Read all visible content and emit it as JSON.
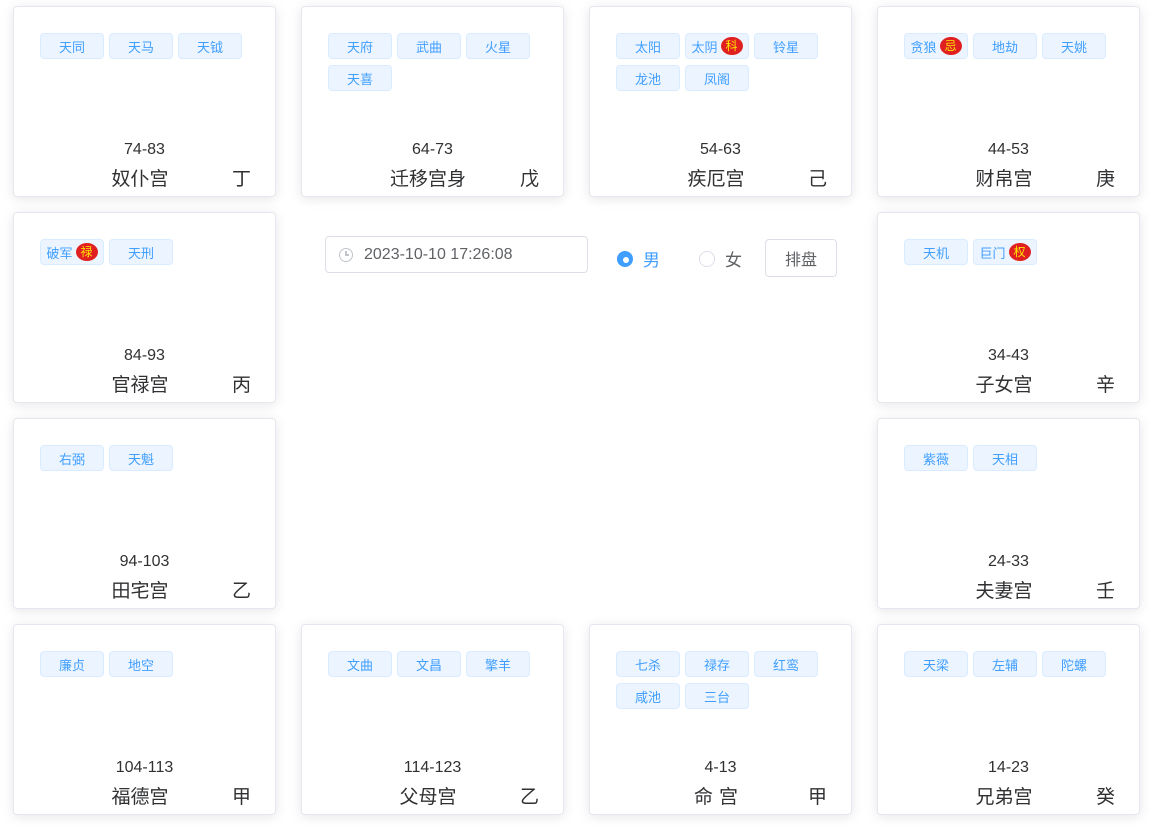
{
  "palaces": [
    {
      "id": "p0",
      "stars": [
        {
          "name": "天同"
        },
        {
          "name": "天马"
        },
        {
          "name": "天钺"
        }
      ],
      "range": "74-83",
      "name": "奴仆宫",
      "stem": "丁"
    },
    {
      "id": "p1",
      "stars": [
        {
          "name": "天府"
        },
        {
          "name": "武曲"
        },
        {
          "name": "火星"
        },
        {
          "name": "天喜"
        }
      ],
      "range": "64-73",
      "name": "迁移宫身",
      "stem": "戊"
    },
    {
      "id": "p2",
      "stars": [
        {
          "name": "太阳"
        },
        {
          "name": "太阴",
          "mark": "科"
        },
        {
          "name": "铃星"
        },
        {
          "name": "龙池"
        },
        {
          "name": "凤阁"
        }
      ],
      "range": "54-63",
      "name": "疾厄宫",
      "stem": "己"
    },
    {
      "id": "p3",
      "stars": [
        {
          "name": "贪狼",
          "mark": "忌"
        },
        {
          "name": "地劫"
        },
        {
          "name": "天姚"
        }
      ],
      "range": "44-53",
      "name": "财帛宫",
      "stem": "庚"
    },
    {
      "id": "p4",
      "stars": [
        {
          "name": "破军",
          "mark": "禄"
        },
        {
          "name": "天刑"
        }
      ],
      "range": "84-93",
      "name": "官禄宫",
      "stem": "丙"
    },
    {
      "id": "p5",
      "stars": [
        {
          "name": "天机"
        },
        {
          "name": "巨门",
          "mark": "权"
        }
      ],
      "range": "34-43",
      "name": "子女宫",
      "stem": "辛"
    },
    {
      "id": "p6",
      "stars": [
        {
          "name": "右弼"
        },
        {
          "name": "天魁"
        }
      ],
      "range": "94-103",
      "name": "田宅宫",
      "stem": "乙"
    },
    {
      "id": "p7",
      "stars": [
        {
          "name": "紫薇"
        },
        {
          "name": "天相"
        }
      ],
      "range": "24-33",
      "name": "夫妻宫",
      "stem": "壬"
    },
    {
      "id": "p8",
      "stars": [
        {
          "name": "廉贞"
        },
        {
          "name": "地空"
        }
      ],
      "range": "104-113",
      "name": "福德宫",
      "stem": "甲"
    },
    {
      "id": "p9",
      "stars": [
        {
          "name": "文曲"
        },
        {
          "name": "文昌"
        },
        {
          "name": "擎羊"
        }
      ],
      "range": "114-123",
      "name": "父母宫",
      "stem": "乙"
    },
    {
      "id": "p10",
      "stars": [
        {
          "name": "七杀"
        },
        {
          "name": "禄存"
        },
        {
          "name": "红鸾"
        },
        {
          "name": "咸池"
        },
        {
          "name": "三台"
        }
      ],
      "range": "4-13",
      "name": "命 宫",
      "stem": "甲"
    },
    {
      "id": "p11",
      "stars": [
        {
          "name": "天梁"
        },
        {
          "name": "左辅"
        },
        {
          "name": "陀螺"
        }
      ],
      "range": "14-23",
      "name": "兄弟宫",
      "stem": "癸"
    }
  ],
  "controls": {
    "datetime": "2023-10-10 17:26:08",
    "gender_male": "男",
    "gender_female": "女",
    "selected_gender": "male",
    "submit_label": "排盘"
  },
  "colors": {
    "tag_bg": "#ecf5ff",
    "tag_text": "#409eff",
    "mark_bg": "#e02020",
    "mark_text": "#ffe600",
    "accent": "#409eff"
  }
}
